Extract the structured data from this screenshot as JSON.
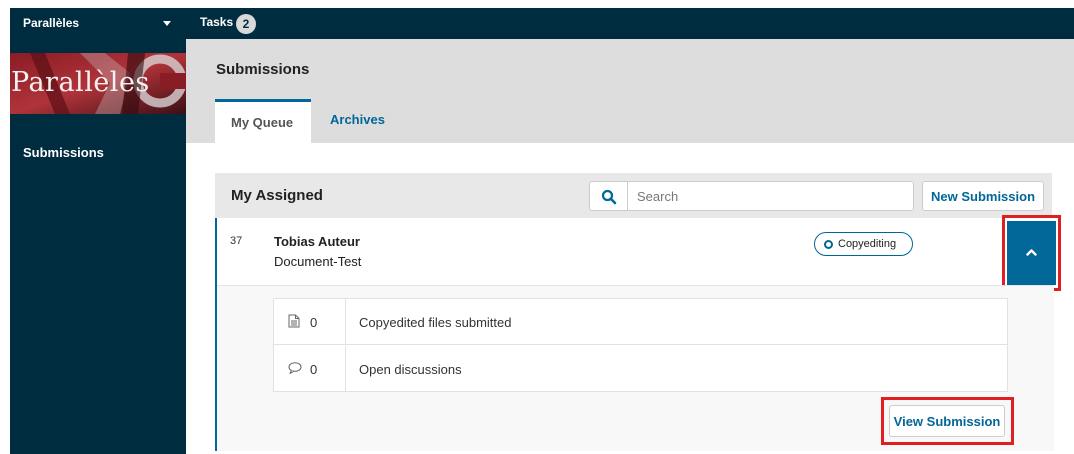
{
  "topbar": {
    "context_name": "Parallèles",
    "tasks_label": "Tasks",
    "tasks_count": "2"
  },
  "sidebar": {
    "logo_text": "Parallèles",
    "items": [
      {
        "label": "Submissions"
      }
    ]
  },
  "header": {
    "title": "Submissions",
    "tabs": [
      {
        "label": "My Queue",
        "active": true
      },
      {
        "label": "Archives",
        "active": false
      }
    ]
  },
  "list": {
    "title": "My Assigned",
    "search_placeholder": "Search",
    "new_submission_label": "New Submission"
  },
  "submission": {
    "id": "37",
    "author": "Tobias Auteur",
    "title": "Document-Test",
    "stage": "Copyediting",
    "stats": [
      {
        "icon": "file-icon",
        "count": "0",
        "label": "Copyedited files submitted"
      },
      {
        "icon": "comment-icon",
        "count": "0",
        "label": "Open discussions"
      }
    ],
    "view_label": "View Submission"
  },
  "colors": {
    "navy": "#002c40",
    "accent": "#006798",
    "highlight": "#e02020"
  }
}
